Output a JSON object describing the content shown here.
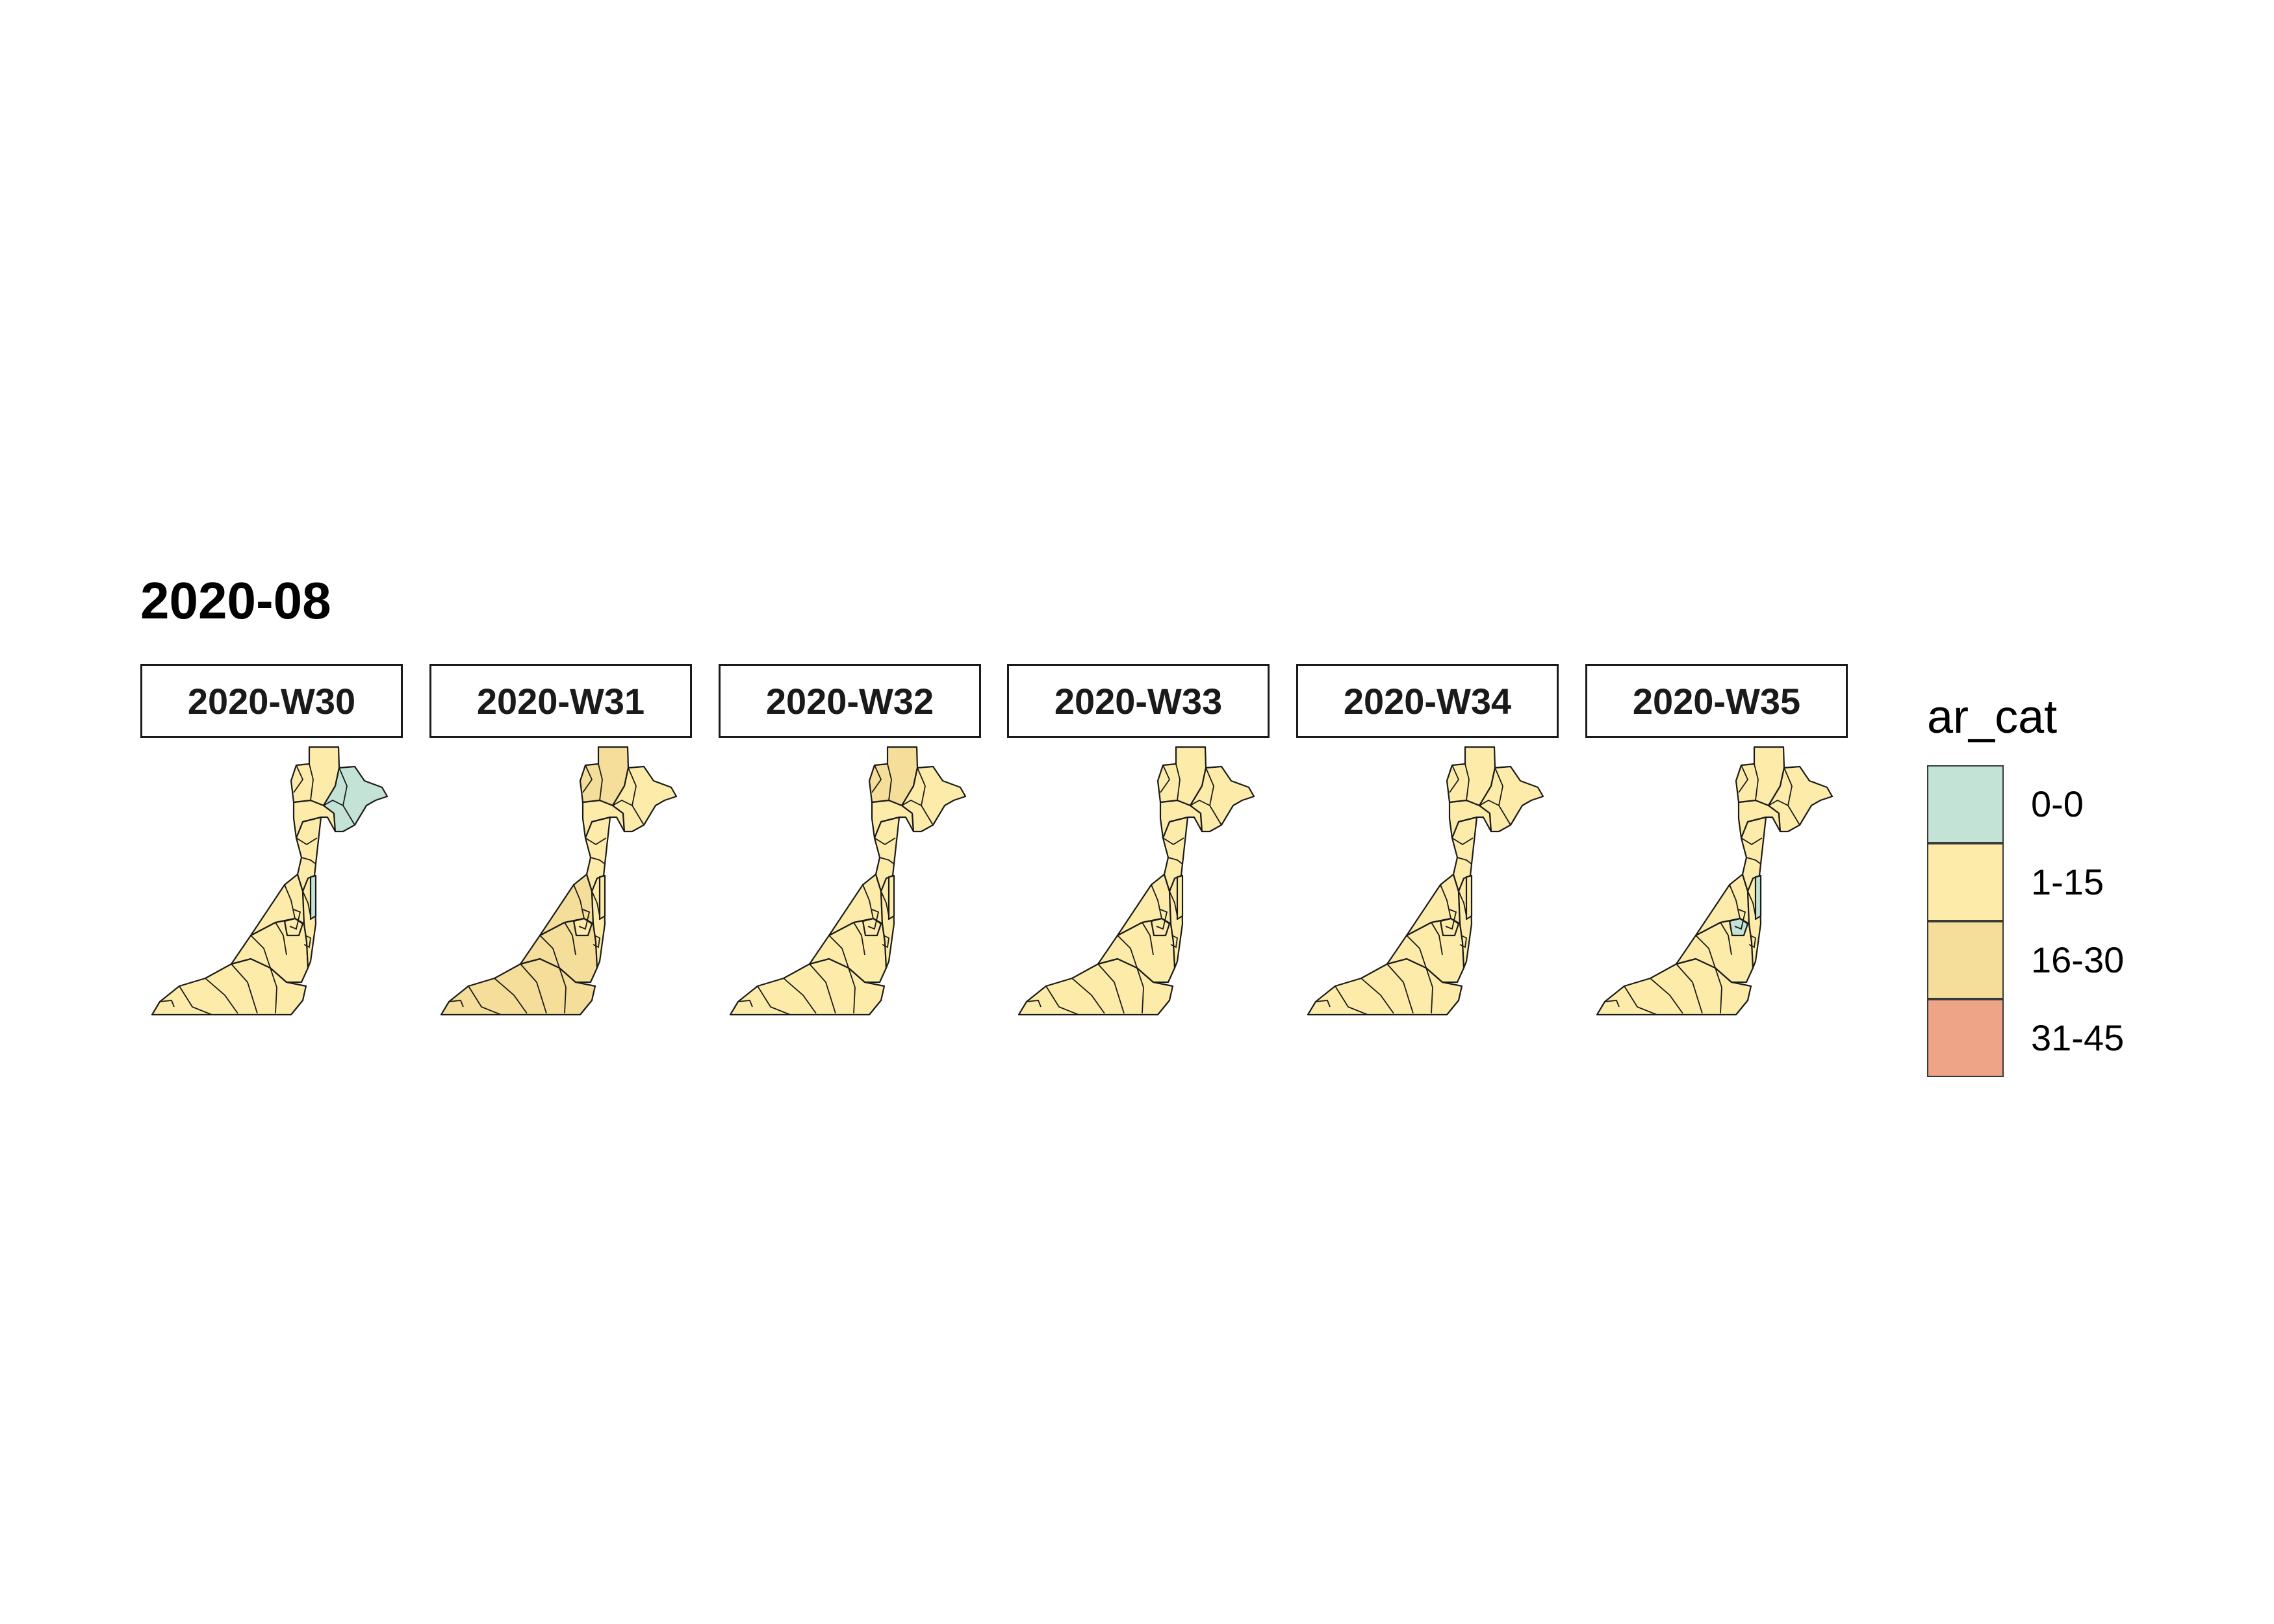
{
  "title": "2020-08",
  "colors": {
    "0-0": "#c2e3d6",
    "1-15": "#fdeca9",
    "16-30": "#f4de9a",
    "31-45": "#eea487",
    "border": "#1a1a1a"
  },
  "legend": {
    "title": "ar_cat",
    "items": [
      {
        "label": "0-0",
        "color": "#c2e3d6"
      },
      {
        "label": "1-15",
        "color": "#fdeca9"
      },
      {
        "label": "16-30",
        "color": "#f4de9a"
      },
      {
        "label": "31-45",
        "color": "#eea487"
      }
    ]
  },
  "panels": [
    {
      "label": "2020-W30",
      "regions": {
        "sw": "1-15",
        "sc": "1-15",
        "mid": "1-15",
        "east": "1-15",
        "neck": "1-15",
        "north": "1-15",
        "nw": "1-15",
        "ne": "0-0",
        "ce": "0-0",
        "cc": "1-15"
      }
    },
    {
      "label": "2020-W31",
      "regions": {
        "sw": "16-30",
        "sc": "16-30",
        "mid": "16-30",
        "east": "1-15",
        "neck": "1-15",
        "north": "1-15",
        "nw": "16-30",
        "ne": "1-15",
        "ce": "1-15",
        "cc": "1-15"
      }
    },
    {
      "label": "2020-W32",
      "regions": {
        "sw": "1-15",
        "sc": "1-15",
        "mid": "1-15",
        "east": "1-15",
        "neck": "1-15",
        "north": "1-15",
        "nw": "16-30",
        "ne": "1-15",
        "ce": "1-15",
        "cc": "1-15"
      }
    },
    {
      "label": "2020-W33",
      "regions": {
        "sw": "1-15",
        "sc": "1-15",
        "mid": "1-15",
        "east": "1-15",
        "neck": "1-15",
        "north": "1-15",
        "nw": "1-15",
        "ne": "1-15",
        "ce": "1-15",
        "cc": "1-15"
      }
    },
    {
      "label": "2020-W34",
      "regions": {
        "sw": "1-15",
        "sc": "1-15",
        "mid": "1-15",
        "east": "1-15",
        "neck": "1-15",
        "north": "1-15",
        "nw": "1-15",
        "ne": "1-15",
        "ce": "1-15",
        "cc": "1-15"
      }
    },
    {
      "label": "2020-W35",
      "regions": {
        "sw": "1-15",
        "sc": "1-15",
        "mid": "1-15",
        "east": "1-15",
        "neck": "1-15",
        "north": "1-15",
        "nw": "1-15",
        "ne": "1-15",
        "ce": "0-0",
        "cc": "0-0"
      }
    }
  ]
}
